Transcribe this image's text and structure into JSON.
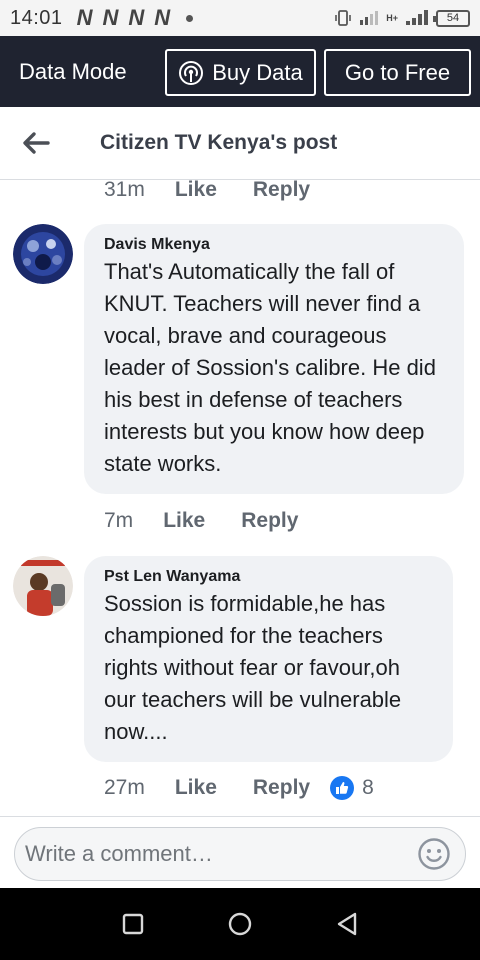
{
  "status_bar": {
    "time": "14:01",
    "notification_letters": [
      "N",
      "N",
      "N",
      "N"
    ],
    "battery": "54",
    "network_label": "H+"
  },
  "data_bar": {
    "mode_label": "Data Mode",
    "buy_data_label": "Buy Data",
    "free_label": "Go to Free"
  },
  "header": {
    "title": "Citizen TV Kenya's post"
  },
  "top_meta": {
    "time": "31m",
    "like": "Like",
    "reply": "Reply"
  },
  "comments": [
    {
      "author": "Davis Mkenya",
      "text": "That's Automatically the fall of KNUT. Teachers will never find a vocal, brave and courageous leader of Sossion's calibre. He did his best in defense of teachers interests but you know how deep state works.",
      "time": "7m",
      "like": "Like",
      "reply": "Reply"
    },
    {
      "author": "Pst Len Wanyama",
      "text": "Sossion is formidable,he has championed for the teachers rights without fear or favour,oh our teachers will be vulnerable now....",
      "time": "27m",
      "like": "Like",
      "reply": "Reply",
      "reaction_count": "8"
    }
  ],
  "composer": {
    "placeholder": "Write a comment…"
  },
  "colors": {
    "data_bar_bg": "#1f2330",
    "bubble_bg": "#f0f2f5",
    "like_blue": "#1877f2",
    "meta_gray": "#606770"
  }
}
